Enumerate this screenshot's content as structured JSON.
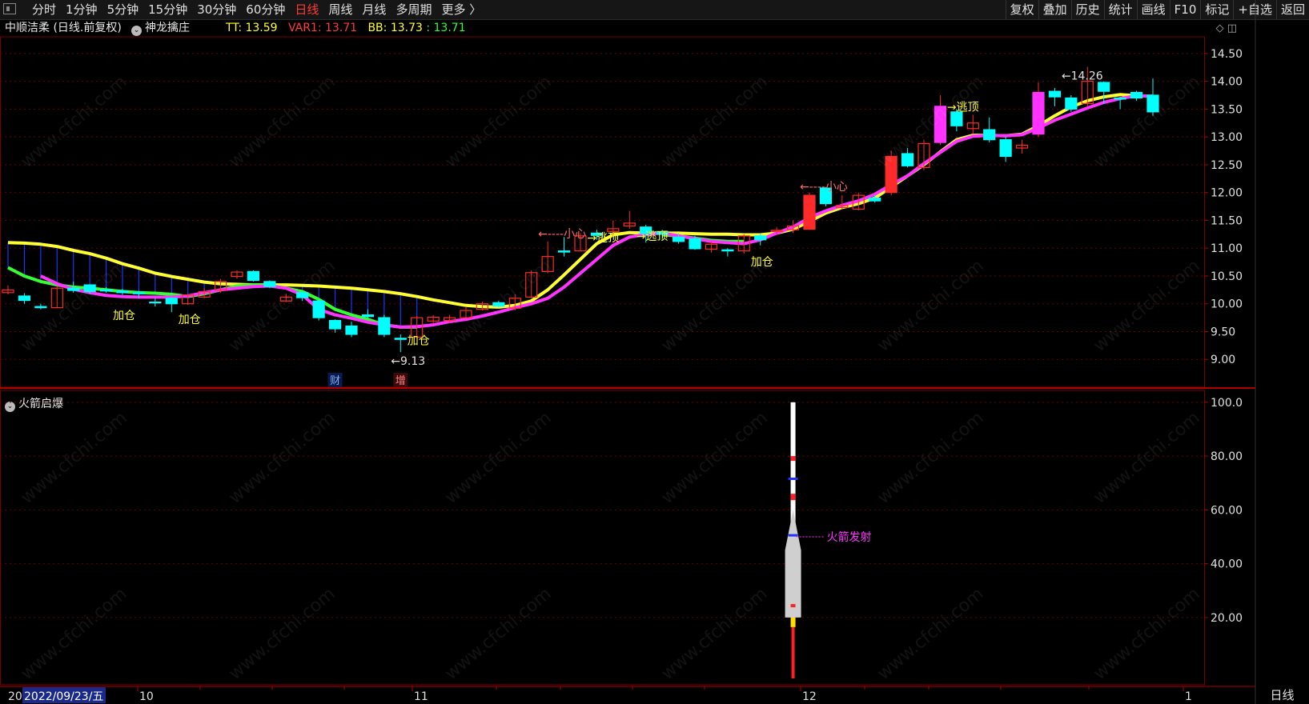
{
  "toolbar": {
    "period_tabs": [
      "分时",
      "1分钟",
      "5分钟",
      "15分钟",
      "30分钟",
      "60分钟",
      "日线",
      "周线",
      "月线",
      "多周期",
      "更多 〉"
    ],
    "active_tab": "日线",
    "right_tools": [
      "复权",
      "叠加",
      "历史",
      "统计",
      "画线",
      "F10",
      "标记",
      "+自选",
      "返回"
    ]
  },
  "info": {
    "stock": "中顺洁柔 (日线.前复权)",
    "indicator": "神龙擒庄",
    "tt": "TT: 13.59",
    "var1": "VAR1: 13.71",
    "bb": "BB: 13.73",
    "bb2": ": 13.71"
  },
  "sub_panel": {
    "title": "火箭启爆"
  },
  "watermark": "www.cfchi.com",
  "colors": {
    "up": "#ff2a2a",
    "down": "#00ffff",
    "yellow": "#ffff33",
    "green": "#33ff33",
    "magenta": "#ff33ff",
    "bg": "#000000",
    "grid": "#6b0000"
  },
  "bottom": {
    "date_label": "2022/09/23/五",
    "period_label": "日线",
    "left_char": "20"
  },
  "chart_data": [
    {
      "type": "candlestick",
      "y_ticks": [
        14.5,
        14.0,
        13.5,
        13.0,
        12.5,
        12.0,
        11.5,
        11.0,
        10.5,
        10.0,
        9.5,
        9.0
      ],
      "ylim": [
        8.5,
        14.8
      ],
      "x_labels": [
        "10",
        "11",
        "12",
        "1"
      ],
      "candles": [
        {
          "o": 10.2,
          "c": 10.25,
          "h": 10.33,
          "l": 10.17
        },
        {
          "o": 10.14,
          "c": 10.06,
          "h": 10.19,
          "l": 10.0
        },
        {
          "o": 9.95,
          "c": 9.93,
          "h": 10.0,
          "l": 9.9
        },
        {
          "o": 9.93,
          "c": 10.28,
          "h": 10.32,
          "l": 9.92
        },
        {
          "o": 10.28,
          "c": 10.24,
          "h": 10.4,
          "l": 10.2
        },
        {
          "o": 10.34,
          "c": 10.22,
          "h": 10.35,
          "l": 10.18
        },
        {
          "o": 10.25,
          "c": 10.23,
          "h": 10.3,
          "l": 10.2
        },
        {
          "o": 10.23,
          "c": 10.2,
          "h": 10.27,
          "l": 10.16
        },
        {
          "o": 10.2,
          "c": 10.18,
          "h": 10.23,
          "l": 10.1
        },
        {
          "o": 10.03,
          "c": 10.02,
          "h": 10.1,
          "l": 9.95
        },
        {
          "o": 10.1,
          "c": 10.0,
          "h": 10.12,
          "l": 9.85
        },
        {
          "o": 10.0,
          "c": 10.16,
          "h": 10.18,
          "l": 9.98
        },
        {
          "o": 10.12,
          "c": 10.22,
          "h": 10.28,
          "l": 10.1
        },
        {
          "o": 10.25,
          "c": 10.4,
          "h": 10.45,
          "l": 10.2
        },
        {
          "o": 10.49,
          "c": 10.57,
          "h": 10.6,
          "l": 10.45
        },
        {
          "o": 10.58,
          "c": 10.42,
          "h": 10.6,
          "l": 10.4
        },
        {
          "o": 10.4,
          "c": 10.31,
          "h": 10.42,
          "l": 10.28
        },
        {
          "o": 10.05,
          "c": 10.12,
          "h": 10.18,
          "l": 10.03
        },
        {
          "o": 10.2,
          "c": 10.11,
          "h": 10.22,
          "l": 10.05
        },
        {
          "o": 10.05,
          "c": 9.75,
          "h": 10.08,
          "l": 9.7
        },
        {
          "o": 9.7,
          "c": 9.55,
          "h": 9.72,
          "l": 9.48
        },
        {
          "o": 9.6,
          "c": 9.45,
          "h": 9.68,
          "l": 9.4
        },
        {
          "o": 9.8,
          "c": 9.77,
          "h": 9.9,
          "l": 9.75
        },
        {
          "o": 9.75,
          "c": 9.45,
          "h": 9.8,
          "l": 9.4
        },
        {
          "o": 9.38,
          "c": 9.36,
          "h": 9.45,
          "l": 9.13
        },
        {
          "o": 9.4,
          "c": 9.75,
          "h": 9.78,
          "l": 9.38
        },
        {
          "o": 9.69,
          "c": 9.76,
          "h": 9.8,
          "l": 9.65
        },
        {
          "o": 9.7,
          "c": 9.75,
          "h": 9.8,
          "l": 9.66
        },
        {
          "o": 9.75,
          "c": 9.88,
          "h": 9.95,
          "l": 9.74
        },
        {
          "o": 9.9,
          "c": 10.0,
          "h": 10.04,
          "l": 9.88
        },
        {
          "o": 10.02,
          "c": 9.96,
          "h": 10.05,
          "l": 9.93
        },
        {
          "o": 9.92,
          "c": 10.1,
          "h": 10.17,
          "l": 9.88
        },
        {
          "o": 10.12,
          "c": 10.56,
          "h": 10.6,
          "l": 10.1
        },
        {
          "o": 10.58,
          "c": 10.85,
          "h": 11.12,
          "l": 10.55
        },
        {
          "o": 10.95,
          "c": 10.93,
          "h": 11.2,
          "l": 10.85
        },
        {
          "o": 10.95,
          "c": 11.22,
          "h": 11.27,
          "l": 10.95
        },
        {
          "o": 11.27,
          "c": 11.23,
          "h": 11.33,
          "l": 11.15
        },
        {
          "o": 11.3,
          "c": 11.35,
          "h": 11.5,
          "l": 11.2
        },
        {
          "o": 11.4,
          "c": 11.45,
          "h": 11.67,
          "l": 11.35
        },
        {
          "o": 11.38,
          "c": 11.26,
          "h": 11.42,
          "l": 11.1
        },
        {
          "o": 11.3,
          "c": 11.25,
          "h": 11.33,
          "l": 11.15
        },
        {
          "o": 11.2,
          "c": 11.12,
          "h": 11.27,
          "l": 11.08
        },
        {
          "o": 11.17,
          "c": 10.99,
          "h": 11.22,
          "l": 10.97
        },
        {
          "o": 10.98,
          "c": 11.07,
          "h": 11.12,
          "l": 10.92
        },
        {
          "o": 10.97,
          "c": 10.95,
          "h": 11.0,
          "l": 10.85
        },
        {
          "o": 10.95,
          "c": 11.22,
          "h": 11.25,
          "l": 10.9
        },
        {
          "o": 11.22,
          "c": 11.15,
          "h": 11.27,
          "l": 11.05
        },
        {
          "o": 11.3,
          "c": 11.32,
          "h": 11.38,
          "l": 11.25
        },
        {
          "o": 11.33,
          "c": 11.4,
          "h": 11.5,
          "l": 11.27
        },
        {
          "o": 11.34,
          "c": 11.95,
          "h": 12.0,
          "l": 11.33
        },
        {
          "o": 12.08,
          "c": 11.8,
          "h": 12.1,
          "l": 11.75
        },
        {
          "o": 11.73,
          "c": 11.77,
          "h": 11.95,
          "l": 11.7
        },
        {
          "o": 11.7,
          "c": 11.95,
          "h": 12.0,
          "l": 11.68
        },
        {
          "o": 11.9,
          "c": 11.85,
          "h": 11.95,
          "l": 11.82
        },
        {
          "o": 12.0,
          "c": 12.65,
          "h": 12.75,
          "l": 11.95
        },
        {
          "o": 12.7,
          "c": 12.48,
          "h": 12.8,
          "l": 12.45
        },
        {
          "o": 12.45,
          "c": 12.88,
          "h": 12.95,
          "l": 12.4
        },
        {
          "o": 12.9,
          "c": 13.55,
          "h": 13.75,
          "l": 12.85
        },
        {
          "o": 13.45,
          "c": 13.2,
          "h": 13.5,
          "l": 13.1
        },
        {
          "o": 13.15,
          "c": 13.25,
          "h": 13.4,
          "l": 13.05
        },
        {
          "o": 13.13,
          "c": 12.95,
          "h": 13.35,
          "l": 12.9
        },
        {
          "o": 12.95,
          "c": 12.65,
          "h": 13.0,
          "l": 12.55
        },
        {
          "o": 12.8,
          "c": 12.85,
          "h": 12.95,
          "l": 12.7
        },
        {
          "o": 13.05,
          "c": 13.8,
          "h": 13.98,
          "l": 13.0
        },
        {
          "o": 13.82,
          "c": 13.72,
          "h": 13.88,
          "l": 13.55
        },
        {
          "o": 13.7,
          "c": 13.5,
          "h": 13.75,
          "l": 13.45
        },
        {
          "o": 13.6,
          "c": 14.0,
          "h": 14.26,
          "l": 13.55
        },
        {
          "o": 13.98,
          "c": 13.82,
          "h": 14.0,
          "l": 13.6
        },
        {
          "o": 13.7,
          "c": 13.68,
          "h": 13.72,
          "l": 13.5
        },
        {
          "o": 13.8,
          "c": 13.7,
          "h": 13.83,
          "l": 13.65
        },
        {
          "o": 13.75,
          "c": 13.45,
          "h": 14.05,
          "l": 13.38
        }
      ],
      "lines": {
        "yellow": [
          11.1,
          11.09,
          11.07,
          11.03,
          10.96,
          10.9,
          10.82,
          10.72,
          10.64,
          10.55,
          10.49,
          10.44,
          10.39,
          10.36,
          10.35,
          10.34,
          10.34,
          10.34,
          10.33,
          10.32,
          10.3,
          10.28,
          10.25,
          10.22,
          10.18,
          10.13,
          10.07,
          10.02,
          9.97,
          9.95,
          9.94,
          9.97,
          10.05,
          10.25,
          10.52,
          10.8,
          11.08,
          11.24,
          11.28,
          11.27,
          11.27,
          11.27,
          11.26,
          11.25,
          11.25,
          11.24,
          11.24,
          11.27,
          11.34,
          11.48,
          11.63,
          11.73,
          11.8,
          11.9,
          12.1,
          12.3,
          12.5,
          12.73,
          12.95,
          13.03,
          13.03,
          13.02,
          13.05,
          13.2,
          13.38,
          13.54,
          13.65,
          13.72,
          13.76,
          13.74,
          13.73
        ],
        "green_end": 46,
        "magenta_start": 17,
        "magenta": [
          10.5,
          10.36,
          10.26,
          10.2,
          10.15,
          10.13,
          10.12,
          10.12,
          10.12,
          10.14,
          10.2,
          10.25,
          10.28,
          10.31,
          10.32,
          10.28,
          10.16,
          9.9,
          9.8,
          9.74,
          9.67,
          9.62,
          9.58,
          9.59,
          9.62,
          9.68,
          9.72,
          9.78,
          9.85,
          9.93,
          10.0,
          10.1,
          10.3,
          10.55,
          10.8,
          11.05,
          11.2,
          11.25,
          11.27,
          11.22,
          11.17,
          11.12,
          11.1,
          11.08,
          11.15,
          11.27,
          11.38,
          11.55,
          11.67,
          11.77,
          11.85,
          11.97,
          12.14,
          12.3,
          12.52,
          12.72,
          12.92,
          13.01,
          13.03,
          13.02,
          13.04,
          13.16,
          13.3,
          13.41,
          13.52,
          13.62,
          13.69,
          13.74,
          13.73
        ]
      },
      "annotations": [
        {
          "text": "加仓",
          "i": 7,
          "v": 9.95
        },
        {
          "text": "加仓",
          "i": 11,
          "v": 9.88
        },
        {
          "text": "加仓",
          "i": 25,
          "v": 9.5
        },
        {
          "text": "←9.13",
          "i": 24,
          "v": 9.13
        },
        {
          "text": "←----小心",
          "i": 33,
          "v": 11.42
        },
        {
          "text": "→逃顶",
          "i": 36,
          "v": 11.35
        },
        {
          "text": "→逃顶",
          "i": 39,
          "v": 11.38
        },
        {
          "text": "加仓",
          "i": 46,
          "v": 10.92
        },
        {
          "text": "←----小心",
          "i": 49,
          "v": 12.27
        },
        {
          "text": "→逃顶",
          "i": 58,
          "v": 13.7
        },
        {
          "text": "←14.26",
          "i": 65,
          "v": 14.26
        }
      ],
      "markers": [
        {
          "text": "财",
          "i": 20
        },
        {
          "text": "增",
          "i": 24
        }
      ]
    },
    {
      "type": "rocket-indicator",
      "y_ticks": [
        100.0,
        80.0,
        60.0,
        40.0,
        20.0
      ],
      "ylim": [
        -5,
        105
      ],
      "rocket_index": 48,
      "rocket_top": 100,
      "rocket_bottom": 20,
      "label": "火箭发射",
      "label_value": 50
    }
  ]
}
